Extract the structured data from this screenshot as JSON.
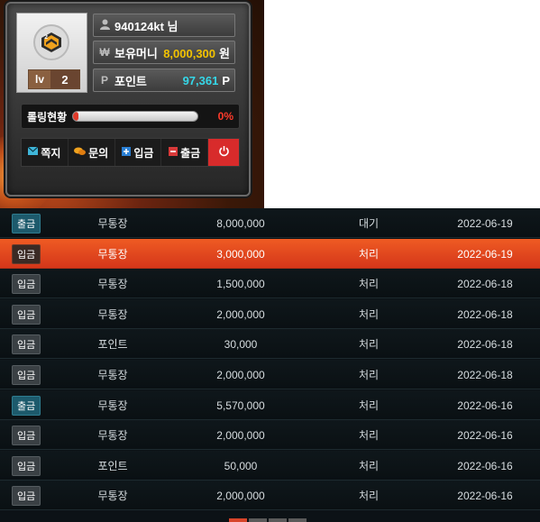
{
  "user": {
    "username": "940124kt 님",
    "money_label": "보유머니",
    "money_value": "8,000,300",
    "money_unit": "원",
    "point_label": "포인트",
    "point_value": "97,361",
    "point_unit": "P",
    "level_prefix": "lv",
    "level": "2",
    "rolling_label": "롤링현황",
    "rolling_percent": "0%",
    "rolling_fraction": 0.0
  },
  "actions": {
    "message": "쪽지",
    "inquiry": "문의",
    "deposit": "입금",
    "withdraw": "출금"
  },
  "colors": {
    "accent": "#e84f22",
    "money": "#f2c200",
    "point": "#35d7e8",
    "power": "#d82b2b"
  },
  "transactions": [
    {
      "type": "출금",
      "method": "무통장",
      "amount": "8,000,000",
      "status": "대기",
      "date": "2022-06-19"
    },
    {
      "type": "입금",
      "method": "무통장",
      "amount": "3,000,000",
      "status": "처리",
      "date": "2022-06-19"
    },
    {
      "type": "입금",
      "method": "무통장",
      "amount": "1,500,000",
      "status": "처리",
      "date": "2022-06-18"
    },
    {
      "type": "입금",
      "method": "무통장",
      "amount": "2,000,000",
      "status": "처리",
      "date": "2022-06-18"
    },
    {
      "type": "입금",
      "method": "포인트",
      "amount": "30,000",
      "status": "처리",
      "date": "2022-06-18"
    },
    {
      "type": "입금",
      "method": "무통장",
      "amount": "2,000,000",
      "status": "처리",
      "date": "2022-06-18"
    },
    {
      "type": "출금",
      "method": "무통장",
      "amount": "5,570,000",
      "status": "처리",
      "date": "2022-06-16"
    },
    {
      "type": "입금",
      "method": "무통장",
      "amount": "2,000,000",
      "status": "처리",
      "date": "2022-06-16"
    },
    {
      "type": "입금",
      "method": "포인트",
      "amount": "50,000",
      "status": "처리",
      "date": "2022-06-16"
    },
    {
      "type": "입금",
      "method": "무통장",
      "amount": "2,000,000",
      "status": "처리",
      "date": "2022-06-16"
    }
  ]
}
